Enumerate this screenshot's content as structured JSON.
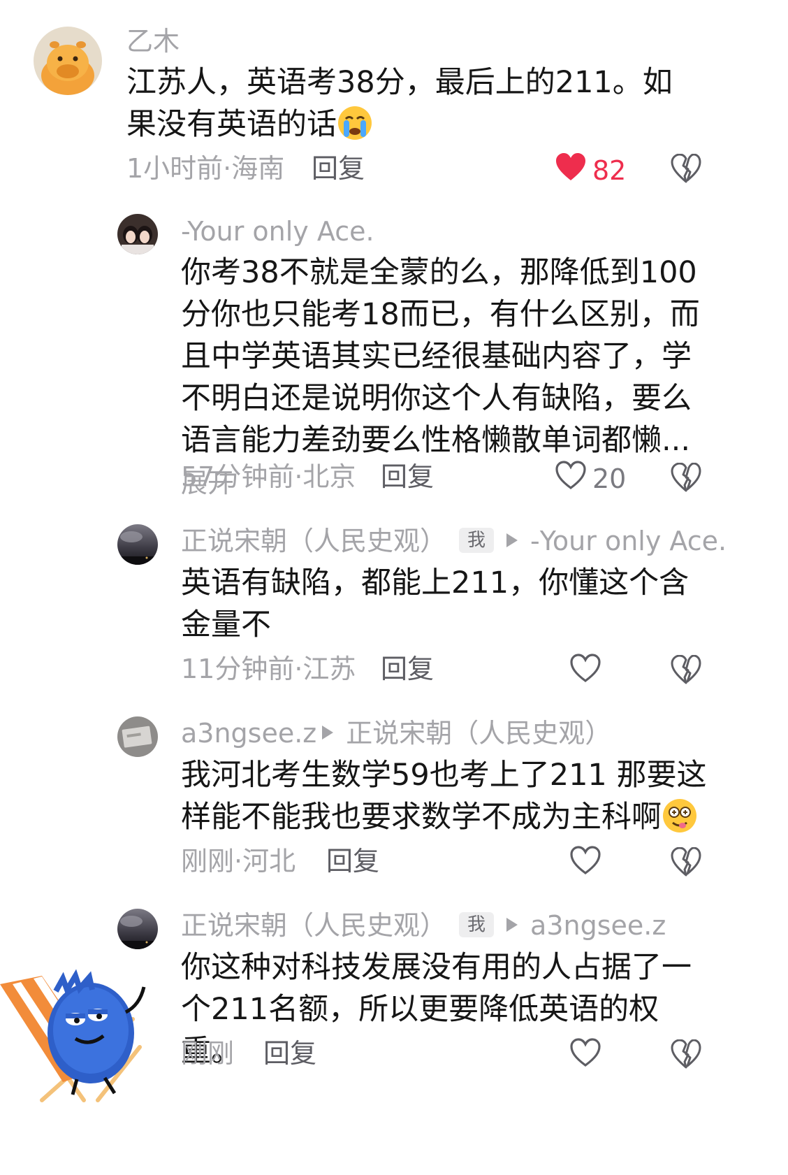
{
  "comments": [
    {
      "username": "乙木",
      "text": "江苏人，英语考38分，最后上的211。如果没有英语的话",
      "time_location": "1小时前·海南",
      "reply_label": "回复",
      "likes": "82",
      "liked": true,
      "avatar": "orange-capybara-avatar",
      "emoji": "crying-face-emoji"
    },
    {
      "username": "-Your only Ace.",
      "text": "你考38不就是全蒙的么，那降低到100分你也只能考18而已，有什么区别，而且中学英语其实已经很基础内容了，学不明白还是说明你这个人有缺陷，要么语言能力差劲要么性格懒散单词都懒",
      "ellipsis": "...",
      "expand_label": "展开",
      "time_location": "57分钟前·北京",
      "reply_label": "回复",
      "likes": "20",
      "liked": false,
      "avatar": "two-girls-photo-avatar"
    },
    {
      "username": "正说宋朝（人民史观）",
      "badge": "我",
      "reply_to": "-Your only Ace.",
      "text": "英语有缺陷，都能上211，你懂这个含金量不",
      "time_location": "11分钟前·江苏",
      "reply_label": "回复",
      "likes": "",
      "liked": false,
      "avatar": "stormy-sky-avatar"
    },
    {
      "username": "a3ngsee.z",
      "reply_to": "正说宋朝（人民史观）",
      "text": "我河北考生数学59也考上了211 那要这样能不能我也要求数学不成为主科啊",
      "time_location": "刚刚·河北",
      "reply_label": "回复",
      "likes": "",
      "liked": false,
      "avatar": "grey-box-avatar",
      "emoji": "dizzy-tongue-face-emoji"
    },
    {
      "username": "正说宋朝（人民史观）",
      "badge": "我",
      "reply_to": "a3ngsee.z",
      "text": "你这种对科技发展没有用的人占据了一个211名额，所以更要降低英语的权重。",
      "time_location": "刚刚",
      "reply_label": "回复",
      "likes": "",
      "liked": false,
      "avatar": "stormy-sky-avatar"
    }
  ],
  "colors": {
    "accent_like": "#ee2d4d",
    "meta_grey": "#a4a4a8",
    "text": "#161616"
  },
  "decorations": {
    "mascot": "blue-furry-monster-on-beach-chair-sticker"
  }
}
